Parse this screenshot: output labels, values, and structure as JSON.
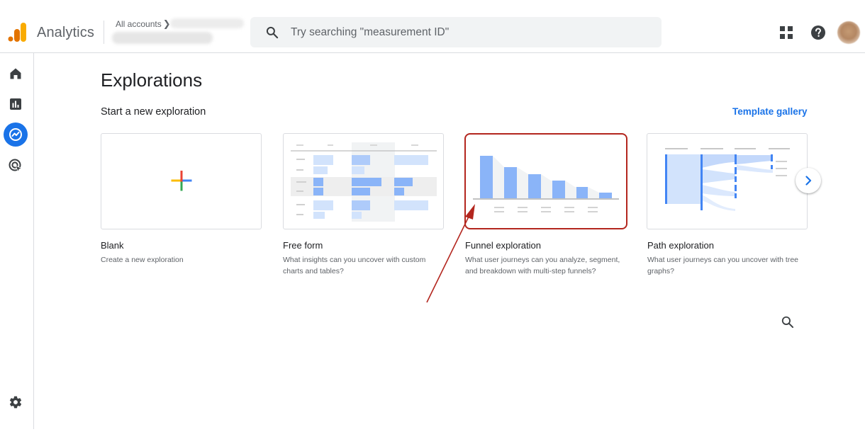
{
  "header": {
    "app_title": "Analytics",
    "account_breadcrumb": "All accounts",
    "search_placeholder": "Try searching \"measurement ID\""
  },
  "sidebar": {
    "items": [
      {
        "name": "home",
        "icon": "home-icon",
        "active": false
      },
      {
        "name": "reports",
        "icon": "bar-chart-icon",
        "active": false
      },
      {
        "name": "explore",
        "icon": "explore-icon",
        "active": true
      },
      {
        "name": "advertising",
        "icon": "ads-target-icon",
        "active": false
      }
    ],
    "settings_icon": "gear-icon"
  },
  "main": {
    "title": "Explorations",
    "section_title": "Start a new exploration",
    "template_gallery_label": "Template gallery",
    "templates": [
      {
        "name": "Blank",
        "description": "Create a new exploration"
      },
      {
        "name": "Free form",
        "description": "What insights can you uncover with custom charts and tables?"
      },
      {
        "name": "Funnel exploration",
        "description": "What user journeys can you analyze, segment, and breakdown with multi-step funnels?",
        "highlighted": true
      },
      {
        "name": "Path exploration",
        "description": "What user journeys can you uncover with tree graphs?"
      }
    ]
  },
  "colors": {
    "accent": "#1a73e8",
    "highlight_border": "#b3261e",
    "annotation_arrow": "#b3261e",
    "illustration_blue": "#8ab4f8",
    "illustration_light_blue": "#d2e3fc"
  }
}
